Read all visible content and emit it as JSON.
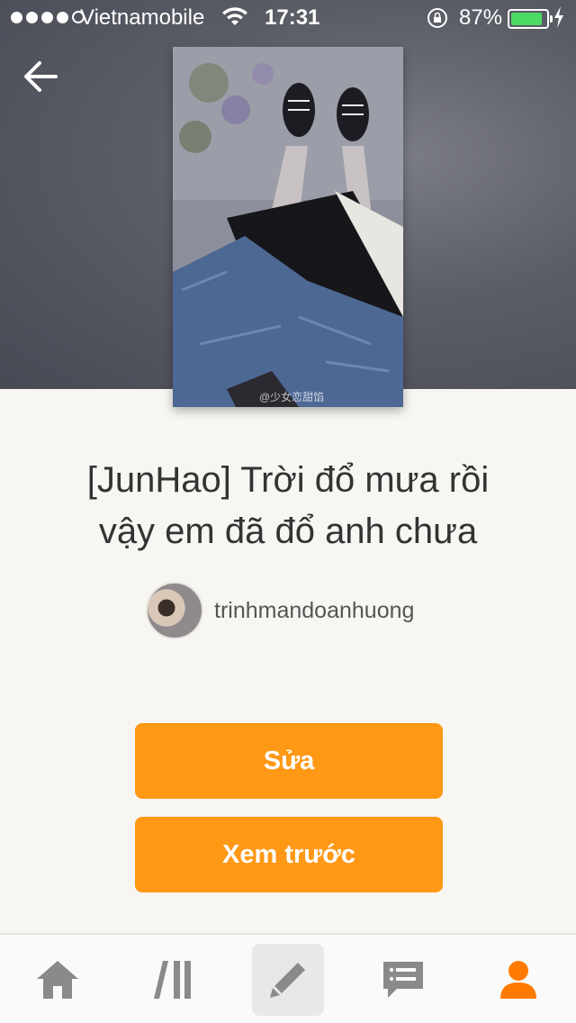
{
  "status_bar": {
    "carrier": "Vietnamobile",
    "time": "17:31",
    "battery_percent": "87%",
    "signal_bars": 4,
    "battery_level": 0.87,
    "battery_color": "#4cd964"
  },
  "header": {
    "back_icon": "arrow-left-icon"
  },
  "cover": {
    "watermark": "@少女恋甜馅"
  },
  "story": {
    "title_line1": "[JunHao] Trời đổ mưa rồi",
    "title_line2": "vậy em đã đổ anh chưa",
    "author": "trinhmandoanhuong"
  },
  "actions": {
    "edit_label": "Sửa",
    "preview_label": "Xem trước",
    "accent_color": "#ff9815"
  },
  "tabbar": {
    "items": [
      {
        "icon": "home-icon",
        "active": false
      },
      {
        "icon": "library-icon",
        "active": false
      },
      {
        "icon": "pencil-icon",
        "active": true
      },
      {
        "icon": "messages-icon",
        "active": false
      },
      {
        "icon": "profile-icon",
        "active": false
      }
    ],
    "profile_color": "#ff7a00"
  }
}
